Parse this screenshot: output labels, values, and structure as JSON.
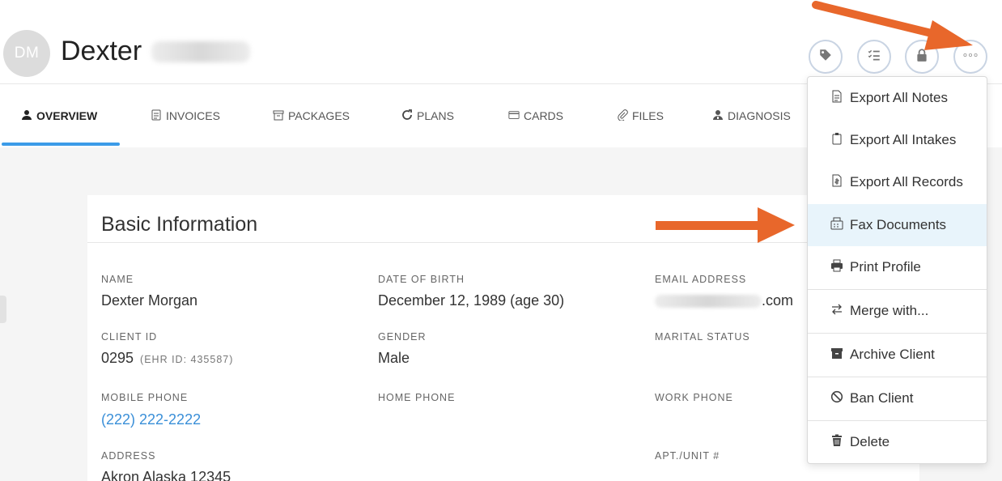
{
  "client": {
    "initials": "DM",
    "first_name": "Dexter"
  },
  "header_actions": [
    {
      "icon": "tag-icon"
    },
    {
      "icon": "checklist-icon"
    },
    {
      "icon": "lock-icon"
    },
    {
      "icon": "more-options-icon"
    }
  ],
  "tabs": [
    {
      "label": "OVERVIEW",
      "icon": "user-icon"
    },
    {
      "label": "INVOICES",
      "icon": "invoice-icon"
    },
    {
      "label": "PACKAGES",
      "icon": "package-icon"
    },
    {
      "label": "PLANS",
      "icon": "refresh-icon"
    },
    {
      "label": "CARDS",
      "icon": "card-icon"
    },
    {
      "label": "FILES",
      "icon": "paperclip-icon"
    },
    {
      "label": "DIAGNOSIS",
      "icon": "doctor-icon"
    }
  ],
  "basic_info": {
    "title": "Basic Information",
    "name_label": "NAME",
    "name_value": "Dexter Morgan",
    "dob_label": "DATE OF BIRTH",
    "dob_value": "December 12, 1989  (age 30)",
    "email_label": "EMAIL ADDRESS",
    "email_suffix": ".com",
    "client_id_label": "CLIENT ID",
    "client_id_value": "0295",
    "ehr_id": "(EHR ID: 435587)",
    "gender_label": "GENDER",
    "gender_value": "Male",
    "marital_label": "MARITAL STATUS",
    "mobile_label": "MOBILE PHONE",
    "mobile_value": "(222) 222-2222",
    "home_label": "HOME PHONE",
    "work_label": "WORK PHONE",
    "address_label": "ADDRESS",
    "address_value": "Akron Alaska 12345",
    "apt_label": "APT./UNIT #"
  },
  "dropdown": {
    "items": [
      {
        "label": "Export All Notes",
        "icon": "document-icon"
      },
      {
        "label": "Export All Intakes",
        "icon": "clipboard-icon"
      },
      {
        "label": "Export All Records",
        "icon": "file-dollar-icon"
      },
      {
        "label": "Fax Documents",
        "icon": "fax-icon"
      },
      {
        "label": "Print Profile",
        "icon": "printer-icon"
      },
      {
        "label": "Merge with...",
        "icon": "swap-arrows-icon"
      },
      {
        "label": "Archive Client",
        "icon": "archive-icon"
      },
      {
        "label": "Ban Client",
        "icon": "ban-icon"
      },
      {
        "label": "Delete",
        "icon": "trash-icon"
      }
    ],
    "highlighted_item": "Fax Documents"
  },
  "colors": {
    "accent_blue": "#3b9be8",
    "link_blue": "#3a8fd8",
    "arrow_orange": "#e8672b",
    "highlight_bg": "#e8f4fb"
  }
}
